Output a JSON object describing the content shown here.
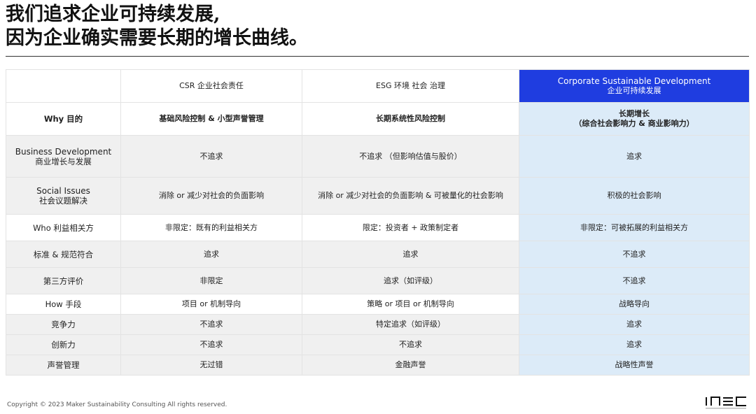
{
  "title": {
    "line1": "我们追求企业可持续发展,",
    "line2": "因为企业确实需要长期的增长曲线。"
  },
  "table": {
    "headers": [
      "",
      "CSR 企业社会责任",
      "ESG 环境 社会 治理"
    ],
    "csd_header": {
      "line1": "Corporate Sustainable Development",
      "line2": "企业可持续发展"
    },
    "why": {
      "label": "Why 目的",
      "csr": "基础风险控制 & 小型声誉管理",
      "esg": "长期系统性风险控制",
      "csd_line1": "长期增长",
      "csd_line2": "（综合社会影响力 & 商业影响力）"
    },
    "rows": [
      {
        "label1": "Business Development",
        "label2": "商业增长与发展",
        "csr": "不追求",
        "esg": "不追求 （但影响估值与股价）",
        "csd": "追求"
      },
      {
        "label1": "Social Issues",
        "label2": "社会议题解决",
        "csr": "消除 or 减少对社会的负面影响",
        "esg": "消除 or 减少对社会的负面影响 & 可被量化的社会影响",
        "csd": "积极的社会影响"
      },
      {
        "label1": "Who 利益相关方",
        "label2": "",
        "csr": "非限定：既有的利益相关方",
        "esg": "限定：投资者 + 政策制定者",
        "csd": "非限定：可被拓展的利益相关方"
      },
      {
        "label1": "标准 & 规范符合",
        "label2": "",
        "csr": "追求",
        "esg": "追求",
        "csd": "不追求"
      },
      {
        "label1": "第三方评价",
        "label2": "",
        "csr": "非限定",
        "esg": "追求（如评级）",
        "csd": "不追求"
      },
      {
        "label1": "How 手段",
        "label2": "",
        "csr": "项目 or 机制导向",
        "esg": "策略 or 项目 or 机制导向",
        "csd": "战略导向"
      },
      {
        "label1": "竞争力",
        "label2": "",
        "csr": "不追求",
        "esg": "特定追求（如评级）",
        "csd": "追求"
      },
      {
        "label1": "创新力",
        "label2": "",
        "csr": "不追求",
        "esg": "不追求",
        "csd": "追求"
      },
      {
        "label1": "声誉管理",
        "label2": "",
        "csr": "无过错",
        "esg": "金融声誉",
        "csd": "战略性声誉"
      }
    ]
  },
  "footer": {
    "copyright": "Copyright © 2023 Maker Sustainability Consulting All rights reserved."
  },
  "colors": {
    "accent": "#1f3de0",
    "highlight_column": "#dcebf8",
    "row_gray": "#f0f0f0"
  }
}
